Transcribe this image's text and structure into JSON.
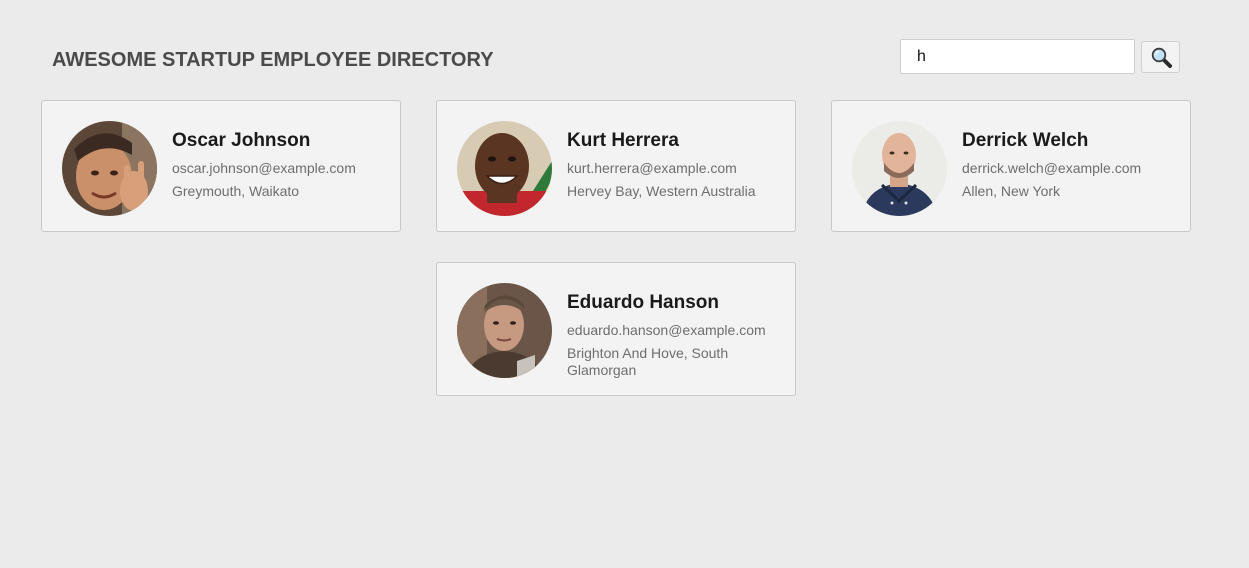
{
  "header": {
    "title": "AWESOME STARTUP EMPLOYEE DIRECTORY"
  },
  "search": {
    "value": "h",
    "button_icon": "search-icon"
  },
  "employees": [
    {
      "name": "Oscar Johnson",
      "email": "oscar.johnson@example.com",
      "location": "Greymouth, Waikato"
    },
    {
      "name": "Kurt Herrera",
      "email": "kurt.herrera@example.com",
      "location": "Hervey Bay, Western Australia"
    },
    {
      "name": "Derrick Welch",
      "email": "derrick.welch@example.com",
      "location": "Allen, New York"
    },
    {
      "name": "Eduardo Hanson",
      "email": "eduardo.hanson@example.com",
      "location": "Brighton And Hove, South Glamorgan"
    }
  ],
  "colors": {
    "background": "#ebebeb",
    "card_background": "#f3f3f3",
    "title_text": "#4a4a4a",
    "secondary_text": "#6e6e6e"
  }
}
